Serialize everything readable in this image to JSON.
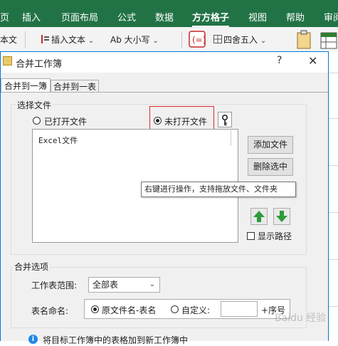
{
  "ribbon": {
    "tabs": [
      "页",
      "插入",
      "页面布局",
      "公式",
      "数据",
      "方方格子",
      "视图",
      "帮助",
      "审阅"
    ],
    "active_tab": "方方格子"
  },
  "toolbar": {
    "items": [
      "本文",
      "插入文本",
      "Ab 大小写",
      "四舍五入"
    ]
  },
  "dialog": {
    "title": "合并工作簿",
    "help": "?",
    "close": "✕",
    "tabs": [
      "合并到一簿",
      "合并到一表"
    ],
    "file_group": {
      "label": "选择文件",
      "radio_opened": "已打开文件",
      "radio_unopened": "未打开文件",
      "selected": "未打开文件",
      "list_header": "Excel文件",
      "add_button": "添加文件",
      "delete_button": "删除选中",
      "show_path": "显示路径",
      "tooltip": "右键进行操作，支持拖放文件、文件夹"
    },
    "merge_group": {
      "label": "合并选项",
      "sheet_range_label": "工作表范围:",
      "sheet_range_value": "全部表",
      "sheet_name_label": "表名命名:",
      "radio_original": "原文件名-表名",
      "radio_custom": "自定义:",
      "selected": "原文件名-表名",
      "custom_value": "",
      "suffix": "+序号"
    },
    "info_text": "将目标工作簿中的表格加到新工作簿中"
  },
  "watermark": "Baidu 经验",
  "colors": {
    "ribbon": "#217346",
    "dialog_border": "#0078d7",
    "highlight": "#e0292b",
    "arrow_green": "#2e9b3a",
    "info_blue": "#1e88e5"
  }
}
